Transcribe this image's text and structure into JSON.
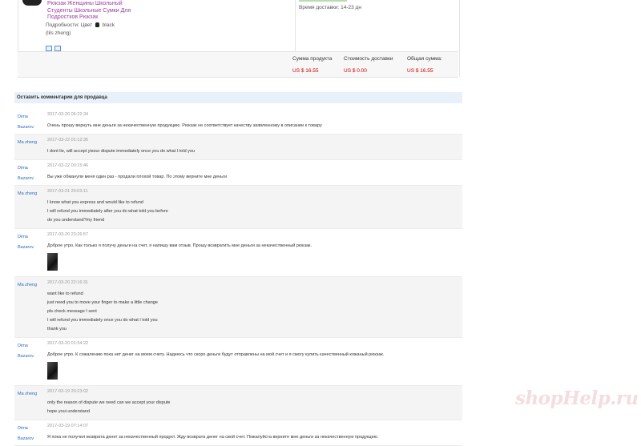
{
  "product": {
    "name_lines": [
      "Рюкзак Женщины Школьный",
      "Студенты Школьные Сумки Для",
      "Подростков Рюкзак"
    ],
    "details_label": "Подробности: Цвет",
    "color": "black",
    "variant": "(lils zheng)"
  },
  "delivery": {
    "label": "Время доставки:",
    "value": "14-23 дн"
  },
  "totals": {
    "product_sum_label": "Сумма продукта",
    "product_sum_value": "US $ 16.55",
    "shipping_cost_label": "Стоимость доставки",
    "shipping_cost_value": "US $ 0.00",
    "total_label": "Общая сумма:",
    "total_value": "US $ 16.55"
  },
  "comments": {
    "title": "Оставить комментарии для продавца",
    "messages": [
      {
        "author": [
          "Dima",
          "Bazarov"
        ],
        "time": "2017-03-26 06:22:34",
        "lines": [
          "Очень прошу вернуть мне деньги за некачественную продукцию. Рюкзак не соответствует качеству заявленному в описании к товару"
        ],
        "photo": false
      },
      {
        "author": [
          "Ma zheng"
        ],
        "time": "2017-03-22 01:12:35",
        "lines": [
          "I dont lie, will accept yisour dispute immediately once you do what I told you"
        ],
        "photo": false
      },
      {
        "author": [
          "Dima",
          "Bazarov"
        ],
        "time": "2017-03-22 00:15:46",
        "lines": [
          "Вы уже обманули меня один раз - продали плохой товар. По этому верните мне деньги"
        ],
        "photo": false
      },
      {
        "author": [
          "Ma zheng"
        ],
        "time": "2017-03-21 20:03:11",
        "lines": [
          "I know what you express and would like to refund",
          "I will refund you immediately after you do what told you before",
          "do you understand?my friend"
        ],
        "photo": false
      },
      {
        "author": [
          "Dima",
          "Bazarov"
        ],
        "time": "2017-03-20 23:26:57",
        "lines": [
          "Доброе утро. Как только я получу деньги на счет, я напишу вам отзыв. Прошу возвратить мне деньги за некачественный рюкзак."
        ],
        "photo": true
      },
      {
        "author": [
          "Ma zheng"
        ],
        "time": "2017-03-20 22:16:31",
        "lines": [
          "want like to refund",
          "just need you to move your finger to make a little change",
          "pls check message I sent",
          "I will refund you immediately once you do what I told you",
          "thank you"
        ],
        "photo": false
      },
      {
        "author": [
          "Dima",
          "Bazarov"
        ],
        "time": "2017-03-20 01:34:22",
        "lines": [
          "Доброе утро. К сожалению пока нет денег на моем счету. Надеюсь что скоро деньги будут отправлены на мой счет и я смогу купить качественный кожаный рюкзак."
        ],
        "photo": true
      },
      {
        "author": [
          "Ma zheng"
        ],
        "time": "2017-03-19 20:23:02",
        "lines": [
          "only the reason of dispute we need can we accept your dispute",
          "hope youi understand"
        ],
        "photo": false
      },
      {
        "author": [
          "Dima",
          "Bazarov"
        ],
        "time": "2017-03-19 07:14:07",
        "lines": [
          "Я пока не получил возврата денег за некачественный продукт. Жду возврата денег на свой счет. Пожалуйста верните мне деньги за некачественную продукцию."
        ],
        "photo": false
      }
    ]
  },
  "watermark": "shopHelp.ru"
}
